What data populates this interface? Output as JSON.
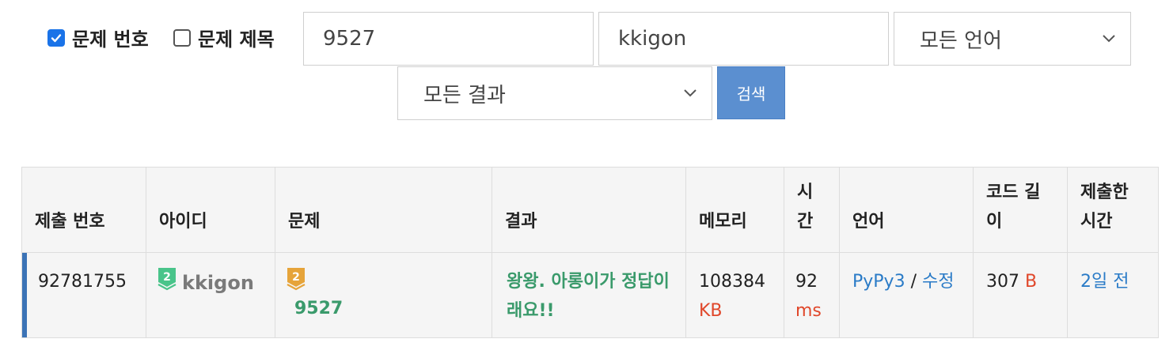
{
  "filters": {
    "problem_number_checkbox": {
      "label": "문제 번호",
      "checked": true
    },
    "problem_title_checkbox": {
      "label": "문제 제목",
      "checked": false
    },
    "problem_input": {
      "value": "9527"
    },
    "user_input": {
      "value": "kkigon"
    },
    "language_select": {
      "selected": "모든 언어"
    },
    "result_select": {
      "selected": "모든 결과"
    },
    "search_button": {
      "label": "검색"
    }
  },
  "table": {
    "headers": {
      "submission": "제출 번호",
      "user": "아이디",
      "problem": "문제",
      "result": "결과",
      "memory": "메모리",
      "time": "시간",
      "language": "언어",
      "code_length": "코드 길이",
      "submitted": "제출한 시간"
    },
    "rows": [
      {
        "submission_id": "92781755",
        "user": "kkigon",
        "user_tier": "2",
        "problem_tier": "2",
        "problem_id": "9527",
        "result": "왕왕. 아롱이가 정답이래요!!",
        "memory": "108384",
        "memory_unit": "KB",
        "time": "92",
        "time_unit": "ms",
        "language": "PyPy3",
        "separator": "/",
        "edit": "수정",
        "code_length": "307",
        "code_unit": "B",
        "submitted": "2일 전"
      }
    ]
  },
  "colors": {
    "accent": "#1a73e8",
    "search_button": "#5b8fd0",
    "accepted": "#3a9a6b",
    "unit_red": "#e0472a",
    "link_blue": "#2a7bc7",
    "row_marker": "#3b73b6",
    "user_tier_badge": "#49c48a",
    "problem_tier_badge": "#e6a43a"
  }
}
